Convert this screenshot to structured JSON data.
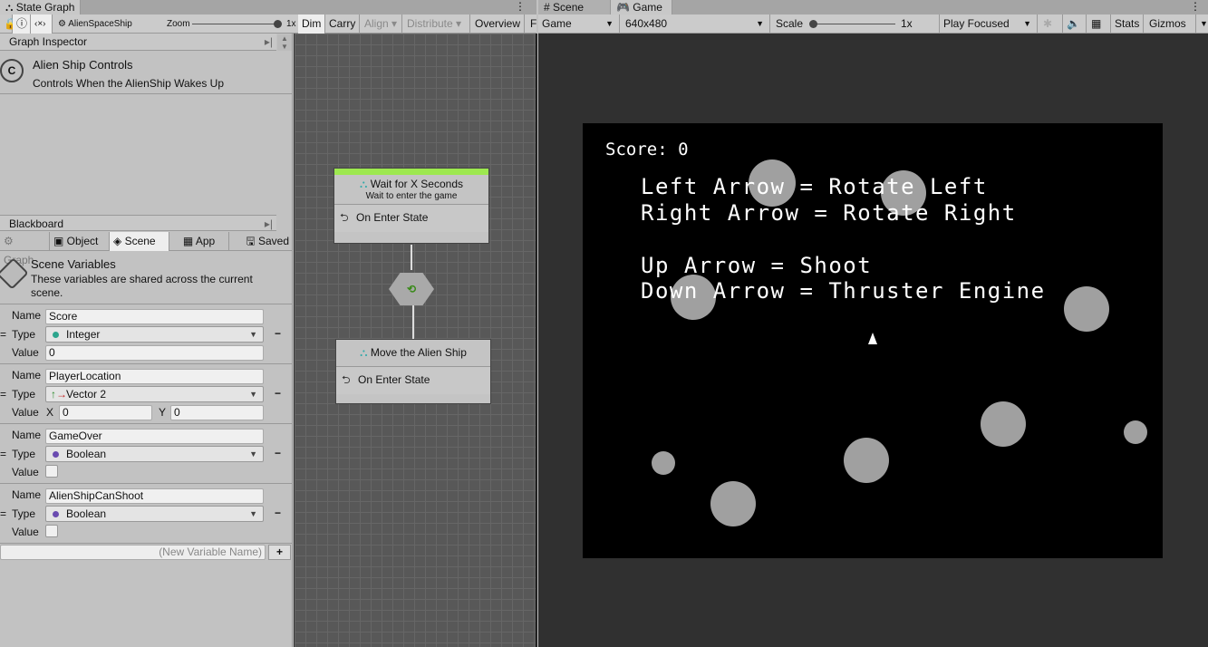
{
  "state_graph": {
    "tab": "State Graph",
    "graph_name": "AlienSpaceShip",
    "zoom_label": "Zoom",
    "zoom_value": "1x",
    "toolbar": [
      "Dim",
      "Carry",
      "Align",
      "Distribute",
      "Overview",
      "F"
    ]
  },
  "inspector": {
    "title": "Graph Inspector",
    "graph_title": "Alien Ship Controls",
    "graph_desc": "Controls When the AlienShip Wakes Up"
  },
  "blackboard": {
    "title": "Blackboard",
    "tabs": [
      "Graph",
      "Object",
      "Scene",
      "App",
      "Saved"
    ],
    "section_title": "Scene Variables",
    "section_desc1": "These variables are shared across the current",
    "section_desc2": "scene.",
    "labels": {
      "name": "Name",
      "type": "Type",
      "value": "Value",
      "x": "X",
      "y": "Y"
    },
    "variables": [
      {
        "name": "Score",
        "type": "Integer",
        "type_color": "#2ca58d",
        "value": "0"
      },
      {
        "name": "PlayerLocation",
        "type": "Vector 2",
        "x": "0",
        "y": "0"
      },
      {
        "name": "GameOver",
        "type": "Boolean",
        "type_color": "#6a4bb0",
        "value": false
      },
      {
        "name": "AlienShipCanShoot",
        "type": "Boolean",
        "type_color": "#6a4bb0",
        "value": false
      }
    ],
    "new_var_placeholder": "(New Variable Name)"
  },
  "graph": {
    "nodes": [
      {
        "title": "Wait for X  Seconds",
        "subtitle": "Wait to enter the game",
        "event": "On Enter State"
      },
      {
        "title": "Move the Alien Ship",
        "event": "On Enter State"
      }
    ]
  },
  "game": {
    "tabs": [
      "Scene",
      "Game"
    ],
    "display": "Game",
    "resolution": "640x480",
    "scale_label": "Scale",
    "scale_value": "1x",
    "play_mode": "Play Focused",
    "stats": "Stats",
    "gizmos": "Gizmos",
    "score": "Score: 0",
    "instructions": [
      "Left Arrow = Rotate Left",
      "Right Arrow = Rotate Right",
      "Up Arrow = Shoot",
      "Down Arrow = Thruster Engine"
    ]
  }
}
